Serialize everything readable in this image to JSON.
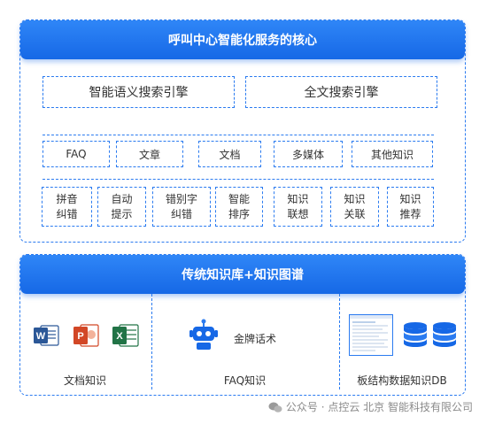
{
  "core": {
    "title": "呼叫中心智能化服务的核心",
    "engines": [
      "智能语义搜索引擎",
      "全文搜索引擎"
    ],
    "types": [
      "FAQ",
      "文章",
      "文档",
      "多媒体",
      "其他知识"
    ],
    "features": [
      [
        "拼音",
        "纠错"
      ],
      [
        "自动",
        "提示"
      ],
      [
        "错别字",
        "纠错"
      ],
      [
        "智能",
        "排序"
      ],
      [
        "知识",
        "联想"
      ],
      [
        "知识",
        "关联"
      ],
      [
        "知识",
        "推荐"
      ]
    ]
  },
  "base": {
    "title": "传统知识库+知识图谱",
    "columns": [
      {
        "caption": "文档知识",
        "icons": [
          "word-icon",
          "powerpoint-icon",
          "excel-icon"
        ]
      },
      {
        "caption": "FAQ知识",
        "robot_label": "金牌话术",
        "icons": [
          "robot-icon"
        ]
      },
      {
        "caption": "板结构数据知识DB",
        "icons": [
          "table-screenshot-icon",
          "database-icon",
          "database-icon"
        ]
      }
    ]
  },
  "watermark": "公众号 · 点控云 北京 智能科技有限公司",
  "colors": {
    "accent": "#1668e6",
    "word": "#2b5797",
    "ppt": "#d24726",
    "excel": "#217346"
  }
}
